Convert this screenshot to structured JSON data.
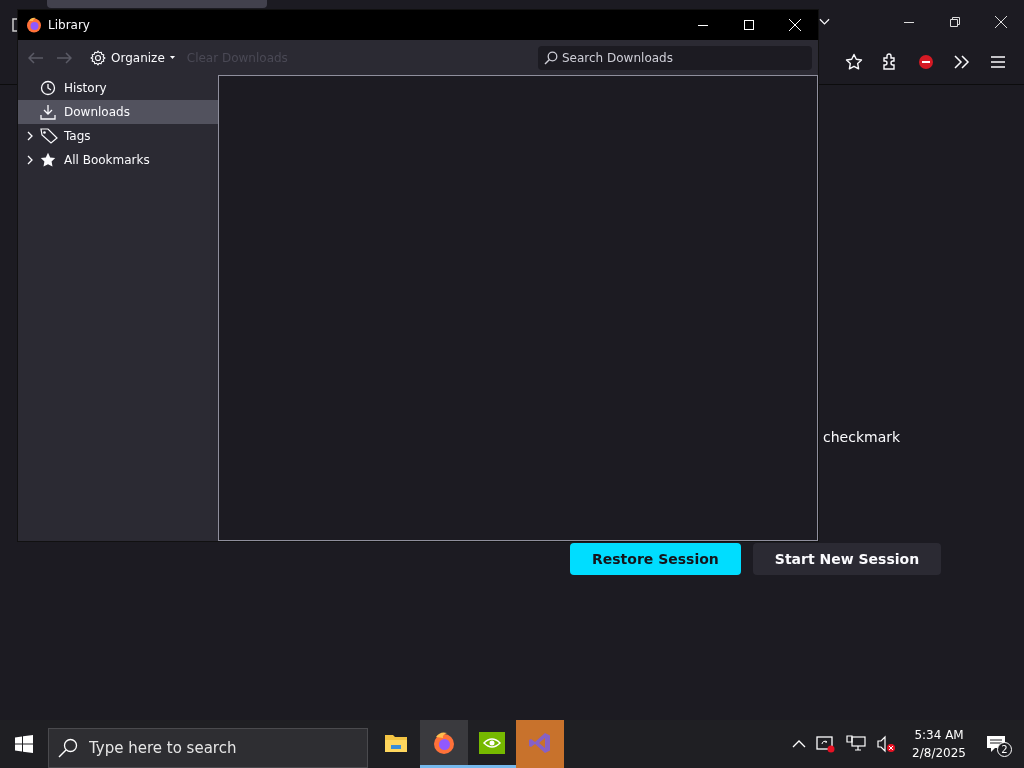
{
  "browser": {
    "page": {
      "text_fragment": "checkmark",
      "buttons": [
        {
          "label": "Restore Session",
          "kind": "primary"
        },
        {
          "label": "Start New Session",
          "kind": "secondary"
        }
      ]
    }
  },
  "library": {
    "window": {
      "title": "Library"
    },
    "toolbar": {
      "back": {
        "disabled": true
      },
      "forward": {
        "disabled": true
      },
      "organize": {
        "label": "Organize"
      },
      "clear": {
        "label": "Clear Downloads",
        "disabled": true
      },
      "search": {
        "placeholder": "Search Downloads"
      }
    },
    "sidebar": {
      "items": [
        {
          "label": "History",
          "kind": "history",
          "selected": false
        },
        {
          "label": "Downloads",
          "kind": "downloads",
          "selected": true
        },
        {
          "label": "Tags",
          "kind": "tags",
          "selected": false,
          "expanded": false
        },
        {
          "label": "All Bookmarks",
          "kind": "bookmarks",
          "selected": false,
          "expanded": false
        }
      ]
    }
  },
  "taskbar": {
    "search": {
      "placeholder": "Type here to search"
    },
    "apps": [
      {
        "kind": "explorer",
        "running": false,
        "active": false
      },
      {
        "kind": "firefox",
        "running": true,
        "active": true
      },
      {
        "kind": "nvidia",
        "running": true,
        "active": false
      },
      {
        "kind": "vs",
        "running": false,
        "active": false,
        "hovered": true
      }
    ],
    "clock": {
      "time": "5:34 AM",
      "date": "2/8/2025"
    },
    "notifications": {
      "count": "2"
    }
  }
}
